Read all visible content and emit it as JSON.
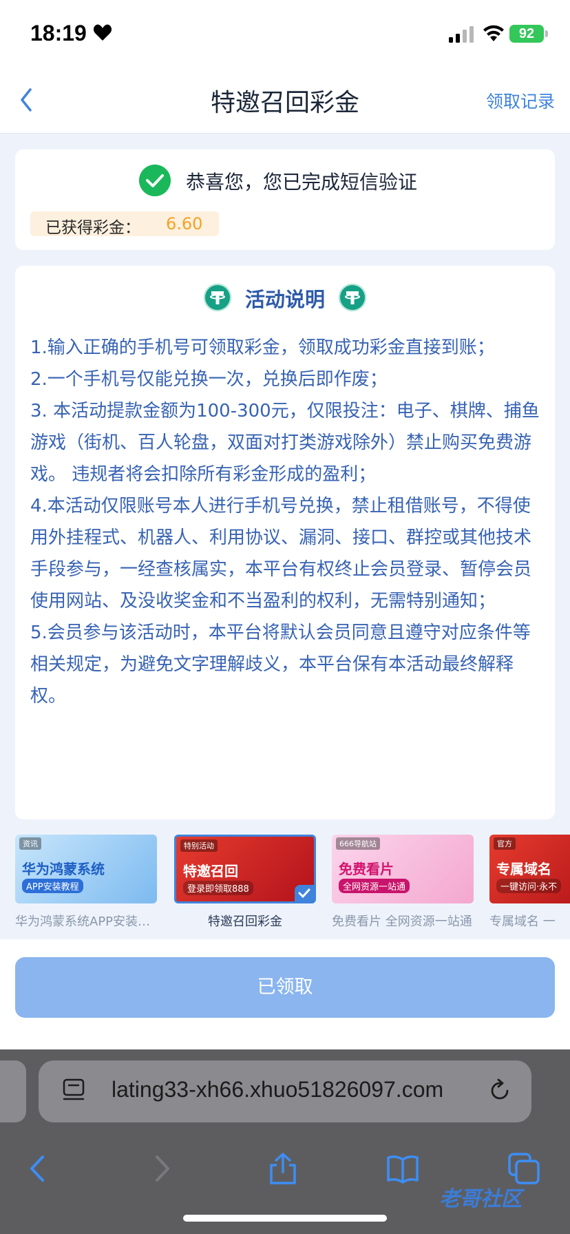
{
  "status_bar": {
    "time": "18:19",
    "battery": "92"
  },
  "nav": {
    "title": "特邀召回彩金",
    "record_link": "领取记录"
  },
  "success": {
    "message": "恭喜您，您已完成短信验证",
    "bonus_label": "已获得彩金：",
    "bonus_value": "6.60"
  },
  "rules": {
    "title": "活动说明",
    "items": [
      "1.输入正确的手机号可领取彩金，领取成功彩金直接到账；",
      "2.一个手机号仅能兑换一次，兑换后即作废；",
      "3. 本活动提款金额为100-300元，仅限投注：电子、棋牌、捕鱼游戏（街机、百人轮盘，双面对打类游戏除外）禁止购买免费游戏。 违规者将会扣除所有彩金形成的盈利；",
      "4.本活动仅限账号本人进行手机号兑换，禁止租借账号，不得使用外挂程式、机器人、利用协议、漏洞、接口、群控或其他技术手段参与，一经查核属实，本平台有权终止会员登录、暂停会员使用网站、及没收奖金和不当盈利的权利，无需特别通知；",
      "5.会员参与该活动时，本平台将默认会员同意且遵守对应条件等相关规定，为避免文字理解歧义，本平台保有本活动最终解释权。"
    ]
  },
  "banners": [
    {
      "tag": "资讯",
      "main": "华为鸿蒙系统",
      "sub": "APP安装教程",
      "caption": "华为鸿蒙系统APP安装教程"
    },
    {
      "tag": "特别活动",
      "main": "特邀召回",
      "sub": "登录即领取888",
      "caption": "特邀召回彩金"
    },
    {
      "tag": "666导航站",
      "main": "免费看片",
      "sub": "全网资源一站通",
      "caption": "免费看片 全网资源一站通"
    },
    {
      "tag": "官方",
      "main": "专属域名",
      "sub": "一键访问·永不",
      "caption": "专属域名 一"
    }
  ],
  "claim_button": {
    "label": "已领取"
  },
  "browser": {
    "url": "lating33-xh66.xhuo51826097.com"
  },
  "watermark": {
    "text": "老哥社区"
  }
}
